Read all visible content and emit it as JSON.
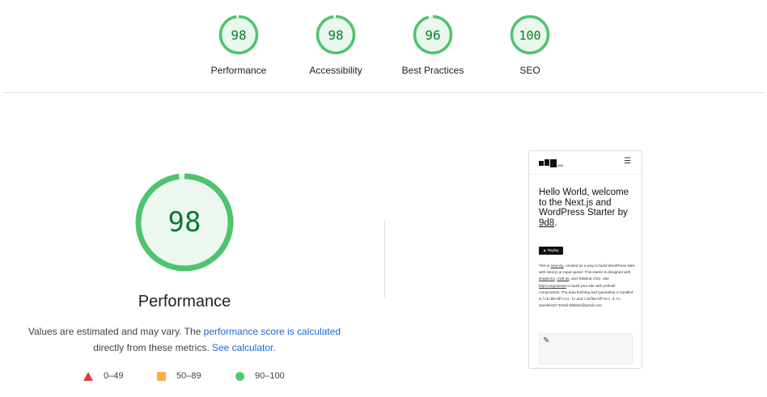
{
  "summary_gauges": [
    {
      "score": "98",
      "label": "Performance"
    },
    {
      "score": "98",
      "label": "Accessibility"
    },
    {
      "score": "96",
      "label": "Best Practices"
    },
    {
      "score": "100",
      "label": "SEO"
    }
  ],
  "colors": {
    "pass": "#0cce6b",
    "average": "#ffa400",
    "fail": "#ff4e42",
    "link": "#1a67d2"
  },
  "main": {
    "score": "98",
    "title": "Performance",
    "desc_part1": "Values are estimated and may vary. The ",
    "desc_link1": "performance score is calculated",
    "desc_part2": "directly from these metrics. ",
    "desc_link2": "See calculator."
  },
  "legend": [
    {
      "range": "0–49",
      "shape": "triangle"
    },
    {
      "range": "50–89",
      "shape": "square"
    },
    {
      "range": "90–100",
      "shape": "circle"
    }
  ],
  "preview": {
    "logo_text": "9d8",
    "menu_icon": "hamburger-icon",
    "hero_part1": "Hello World, welcome to the Next.js and WordPress Starter by ",
    "hero_link": "9d8",
    "hero_end": ".",
    "replay_label": "▲ Replay",
    "body": {
      "t1": "This is ",
      "l1": "next-wp",
      "t2": ", created as a way to build WordPress sites with Next.js at rapid speed. This starter is designed with ",
      "l2": "shadcn/ui",
      "t3": ", ",
      "l3": "craft-ds",
      "t4": ", and Tailwind CSS. Use ",
      "l4": "brijr/components",
      "t5": " to build your site with prebuilt components. The data fetching and typesafety is handled in ",
      "c1": "lib/WordPress.ts",
      "t6": " and ",
      "c2": "lib/WordPress.d.ts",
      "t7": ". Questions? Email 9d8dev@gmail.com"
    },
    "edit_icon": "pencil-icon"
  }
}
